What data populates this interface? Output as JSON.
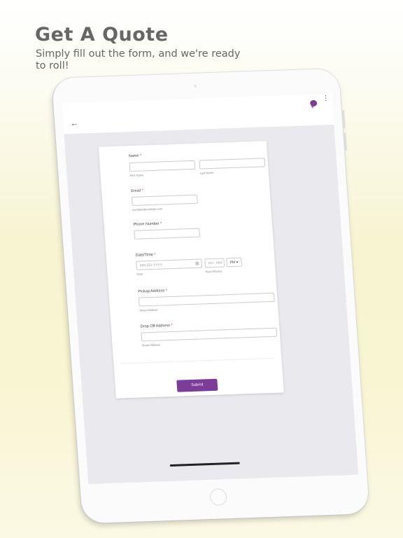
{
  "hero": {
    "title": "Get A Quote",
    "subtitle": "Simply fill out the form, and we're ready to roll!"
  },
  "app": {
    "icons": [
      "back-arrow-icon",
      "chat-icon",
      "more-vert-icon"
    ],
    "accent_color": "#7d3c98"
  },
  "form": {
    "name": {
      "label": "Name",
      "required_mark": "*",
      "first_sub": "First Name",
      "last_sub": "Last Name"
    },
    "email": {
      "label": "Email",
      "required_mark": "*",
      "sub": "example@example.com"
    },
    "phone": {
      "label": "Phone Number",
      "required_mark": "*"
    },
    "datetime": {
      "label": "Date/Time",
      "required_mark": "*",
      "date_placeholder": "MM-DD-YYYY",
      "time_placeholder": "HH : MM",
      "ampm_value": "PM",
      "date_sub": "Date",
      "time_sub": "Hour Minutes"
    },
    "pickup": {
      "label": "Pickup Address",
      "required_mark": "*",
      "sub": "Street Address"
    },
    "dropoff": {
      "label": "Drop Off Address",
      "required_mark": "*",
      "sub": "Street Address"
    },
    "submit_label": "Submit"
  }
}
